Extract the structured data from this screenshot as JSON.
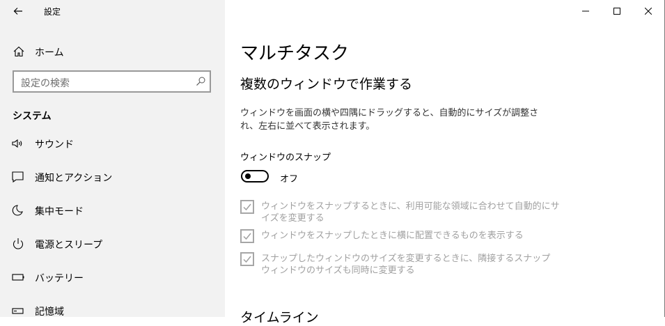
{
  "window": {
    "title": "設定"
  },
  "sidebar": {
    "home_label": "ホーム",
    "search_placeholder": "設定の検索",
    "section": "システム",
    "items": [
      {
        "label": "サウンド",
        "icon": "speaker-icon"
      },
      {
        "label": "通知とアクション",
        "icon": "notification-icon"
      },
      {
        "label": "集中モード",
        "icon": "moon-icon"
      },
      {
        "label": "電源とスリープ",
        "icon": "power-icon"
      },
      {
        "label": "バッテリー",
        "icon": "battery-icon"
      },
      {
        "label": "記憶域",
        "icon": "storage-icon"
      }
    ]
  },
  "main": {
    "title": "マルチタスク",
    "subhead": "複数のウィンドウで作業する",
    "description": "ウィンドウを画面の横や四隅にドラッグすると、自動的にサイズが調整され、左右に並べて表示されます。",
    "snap_label": "ウィンドウのスナップ",
    "snap_toggle_state": "オフ",
    "options": [
      {
        "text": "ウィンドウをスナップするときに、利用可能な領域に合わせて自動的にサイズを変更する",
        "checked": true
      },
      {
        "text": "ウィンドウをスナップしたときに横に配置できるものを表示する",
        "checked": true
      },
      {
        "text": "スナップしたウィンドウのサイズを変更するときに、隣接するスナップ ウィンドウのサイズも同時に変更する",
        "checked": true
      }
    ],
    "next_section": "タイムライン"
  },
  "colors": {
    "sidebar_bg": "#f2f2f2",
    "disabled_text": "#a0a0a0",
    "disabled_border": "#a6a6a6"
  }
}
